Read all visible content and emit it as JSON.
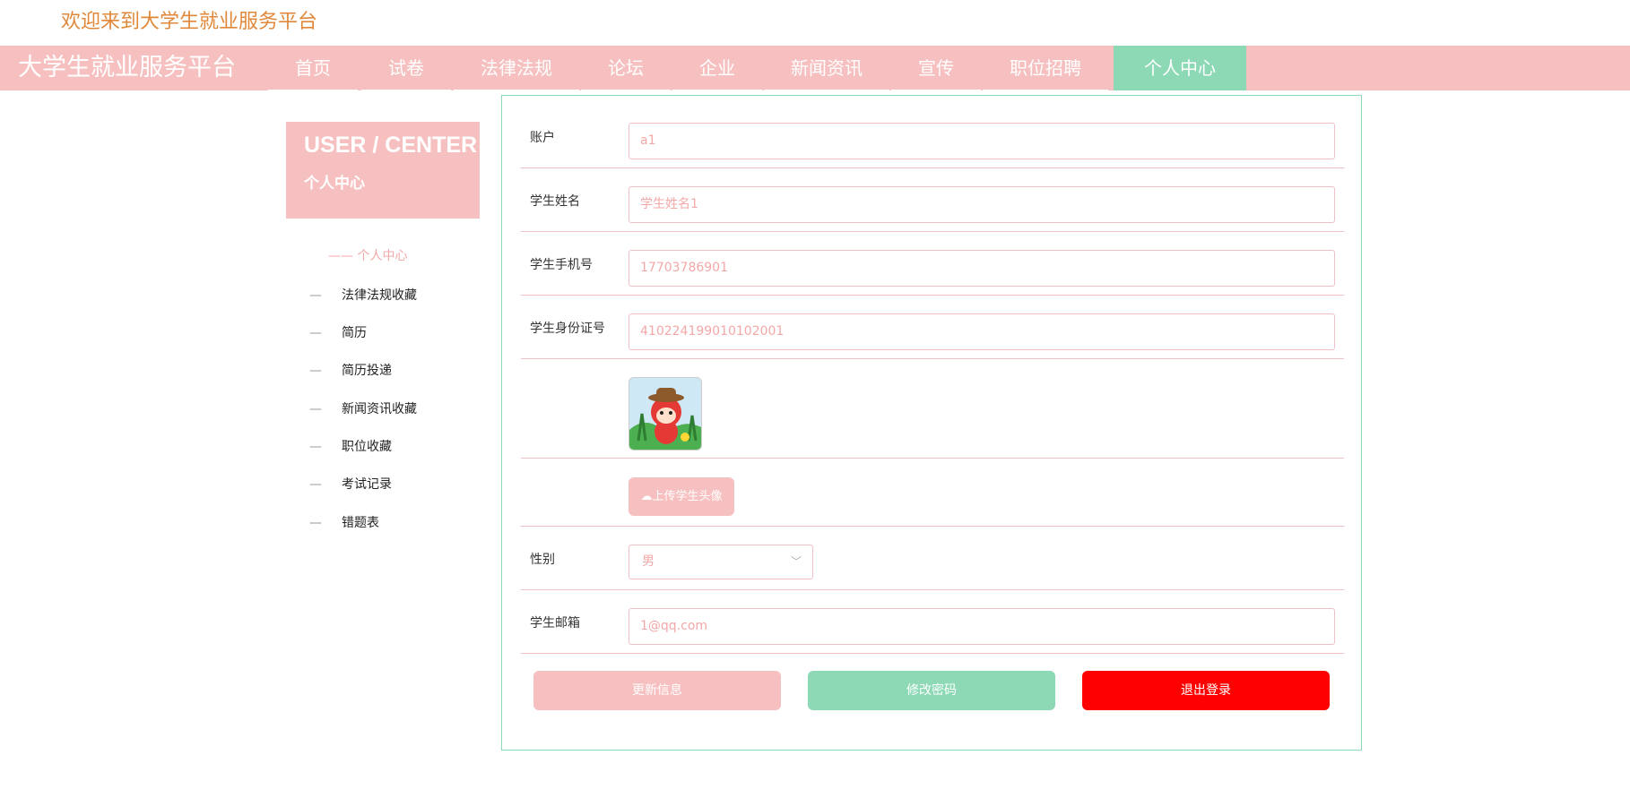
{
  "welcome_text": "欢迎来到大学生就业服务平台",
  "brand": "大学生就业服务平台",
  "nav": [
    "首页",
    "试卷",
    "法律法规",
    "论坛",
    "企业",
    "新闻资讯",
    "宣传",
    "职位招聘",
    "个人中心"
  ],
  "nav_active": "个人中心",
  "sidebar": {
    "title_en": "USER / CENTER",
    "title_cn": "个人中心",
    "current": "—— 个人中心",
    "items": [
      "法律法规收藏",
      "简历",
      "简历投递",
      "新闻资讯收藏",
      "职位收藏",
      "考试记录",
      "错题表"
    ],
    "dash": "—"
  },
  "form": {
    "account_label": "账户",
    "account_value": "a1",
    "name_label": "学生姓名",
    "name_value": "学生姓名1",
    "phone_label": "学生手机号",
    "phone_value": "17703786901",
    "idcard_label": "学生身份证号",
    "idcard_value": "410224199010102001",
    "upload_label": "上传学生头像",
    "gender_label": "性别",
    "gender_value": "男",
    "email_label": "学生邮箱",
    "email_value": "1@qq.com"
  },
  "buttons": {
    "update": "更新信息",
    "change_password": "修改密码",
    "logout": "退出登录"
  },
  "colors": {
    "pink": "#f7c0c0",
    "green": "#8dd9b6",
    "red": "#ff0000",
    "orange_text": "#e0883a"
  }
}
